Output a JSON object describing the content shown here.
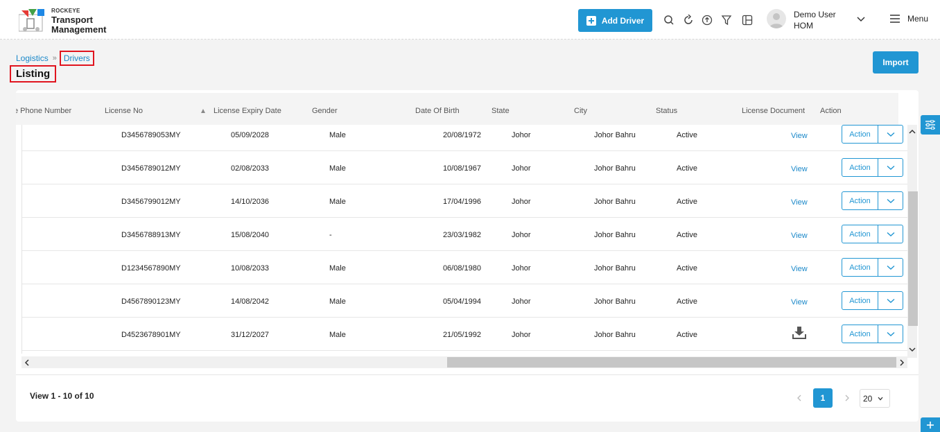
{
  "app": {
    "brand_small": "ROCKEYE",
    "brand_line1": "Transport",
    "brand_line2": "Management"
  },
  "header": {
    "add_driver_label": "Add Driver",
    "icons": [
      "search-icon",
      "refresh-icon",
      "upload-icon",
      "filter-icon",
      "columns-icon"
    ],
    "user_name": "Demo User",
    "user_branch": "HOM",
    "menu_label": "Menu"
  },
  "breadcrumb": [
    "Logistics",
    "Drivers"
  ],
  "page_title": "Listing",
  "import_label": "Import",
  "table": {
    "columns": [
      "e Phone Number",
      "License No",
      "License Expiry Date",
      "Gender",
      "Date Of Birth",
      "State",
      "City",
      "Status",
      "License Document",
      "Action"
    ],
    "rows": [
      {
        "license_no": "D3456789053MY",
        "expiry": "05/09/2028",
        "gender": "Male",
        "dob": "20/08/1972",
        "state": "Johor",
        "city": "Johor Bahru",
        "status": "Active",
        "doc": "View",
        "action": "Action"
      },
      {
        "license_no": "D3456789012MY",
        "expiry": "02/08/2033",
        "gender": "Male",
        "dob": "10/08/1967",
        "state": "Johor",
        "city": "Johor Bahru",
        "status": "Active",
        "doc": "View",
        "action": "Action"
      },
      {
        "license_no": "D3456799012MY",
        "expiry": "14/10/2036",
        "gender": "Male",
        "dob": "17/04/1996",
        "state": "Johor",
        "city": "Johor Bahru",
        "status": "Active",
        "doc": "View",
        "action": "Action"
      },
      {
        "license_no": "D3456788913MY",
        "expiry": "15/08/2040",
        "gender": "-",
        "dob": "23/03/1982",
        "state": "Johor",
        "city": "Johor Bahru",
        "status": "Active",
        "doc": "View",
        "action": "Action"
      },
      {
        "license_no": "D1234567890MY",
        "expiry": "10/08/2033",
        "gender": "Male",
        "dob": "06/08/1980",
        "state": "Johor",
        "city": "Johor Bahru",
        "status": "Active",
        "doc": "View",
        "action": "Action"
      },
      {
        "license_no": "D4567890123MY",
        "expiry": "14/08/2042",
        "gender": "Male",
        "dob": "05/04/1994",
        "state": "Johor",
        "city": "Johor Bahru",
        "status": "Active",
        "doc": "View",
        "action": "Action"
      },
      {
        "license_no": "D4523678901MY",
        "expiry": "31/12/2027",
        "gender": "Male",
        "dob": "21/05/1992",
        "state": "Johor",
        "city": "Johor Bahru",
        "status": "Active",
        "doc": "",
        "action": "Action"
      }
    ]
  },
  "footer": {
    "view_count": "View 1 - 10 of 10",
    "current_page": "1",
    "page_size": "20"
  },
  "colors": {
    "primary": "#2196d3",
    "highlight": "#e0141e"
  }
}
